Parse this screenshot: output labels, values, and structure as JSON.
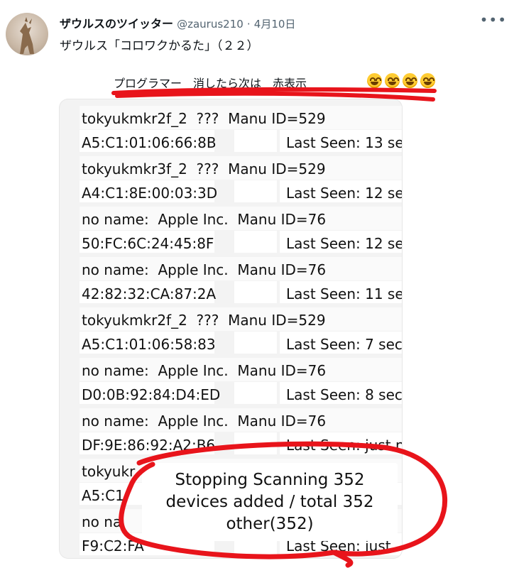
{
  "tweet": {
    "author_name": "ザウルスのツイッター",
    "handle": "@zaurus210",
    "separator": "·",
    "date": "4月10日",
    "more_icon": "more-icon",
    "text": "ザウルス「コロワクかるた」（２２）"
  },
  "image": {
    "caption": "プログラマー　消したら次は　赤表示",
    "emoji_icon": "grinning-face-icon",
    "emoji_count": 4,
    "annotation_color": "#e8141b",
    "devices": [
      {
        "line1": "tokyukmkr2f_2  ???  Manu ID=529",
        "line2": "A5:C1:01:06:66:8B",
        "seen": "Last Seen: 13 se"
      },
      {
        "line1": "tokyukmkr3f_2  ???  Manu ID=529",
        "line2": "A4:C1:8E:00:03:3D",
        "seen": "Last Seen: 12 se"
      },
      {
        "line1": "no name:  Apple Inc.  Manu ID=76",
        "line2": "50:FC:6C:24:45:8F",
        "seen": "Last Seen: 12 se"
      },
      {
        "line1": "no name:  Apple Inc.  Manu ID=76",
        "line2": "42:82:32:CA:87:2A",
        "seen": "Last Seen: 11 se"
      },
      {
        "line1": "tokyukmkr2f_2  ???  Manu ID=529",
        "line2": "A5:C1:01:06:58:83",
        "seen": "Last Seen: 7 sec"
      },
      {
        "line1": "no name:  Apple Inc.  Manu ID=76",
        "line2": "D0:0B:92:84:D4:ED",
        "seen": "Last Seen: 8 sec"
      },
      {
        "line1": "no name:  Apple Inc.  Manu ID=76",
        "line2": "DF:9E:86:92:A2:B6",
        "seen": "Last Seen: just n"
      },
      {
        "line1": "tokyukr",
        "line2": "A5:C1",
        "seen": ""
      },
      {
        "line1": "no na",
        "line2": "F9:C2:FA",
        "seen": "Last Seen: just"
      }
    ],
    "toast": {
      "line1": "Stopping Scanning 352",
      "line2": "devices added / total 352",
      "line3": "other(352)"
    }
  }
}
